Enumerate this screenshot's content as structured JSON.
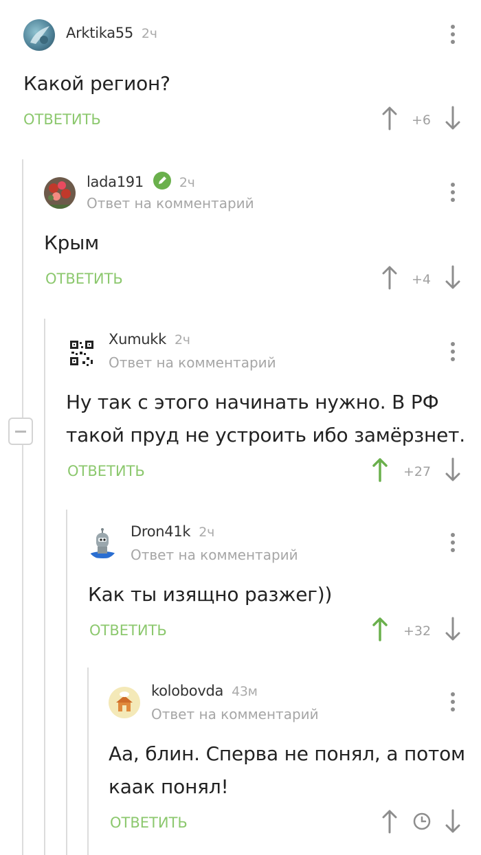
{
  "comments": [
    {
      "author": "Arktika55",
      "time": "2ч",
      "subline": "",
      "text": "Какой регион?",
      "reply_label": "ОТВЕТИТЬ",
      "score": "+6",
      "voted_up": false
    },
    {
      "author": "lada191",
      "time": "2ч",
      "subline": "Ответ на комментарий",
      "text": "Крым",
      "reply_label": "ОТВЕТИТЬ",
      "score": "+4",
      "voted_up": false,
      "verified": true
    },
    {
      "author": "Xumukk",
      "time": "2ч",
      "subline": "Ответ на комментарий",
      "text_lines": [
        "Ну так с этого начинать нужно. В РФ",
        "такой пруд не устроить ибо замёрзнет."
      ],
      "reply_label": "ОТВЕТИТЬ",
      "score": "+27",
      "voted_up": true
    },
    {
      "author": "Dron41k",
      "time": "2ч",
      "subline": "Ответ на комментарий",
      "text": "Как ты изящно разжег))",
      "reply_label": "ОТВЕТИТЬ",
      "score": "+32",
      "voted_up": true
    },
    {
      "author": "kolobovda",
      "time": "43м",
      "subline": "Ответ на комментарий",
      "text_lines": [
        "Аа, блин. Сперва не понял, а потом",
        "каак понял!"
      ],
      "reply_label": "ОТВЕТИТЬ",
      "score": "",
      "score_icon": "clock-icon",
      "voted_up": false
    }
  ],
  "colors": {
    "accent_green": "#8cc86e",
    "upvoted_green": "#6ab04c",
    "arrow_gray": "#8d8d8d",
    "thread_line": "#dcdcdc"
  }
}
